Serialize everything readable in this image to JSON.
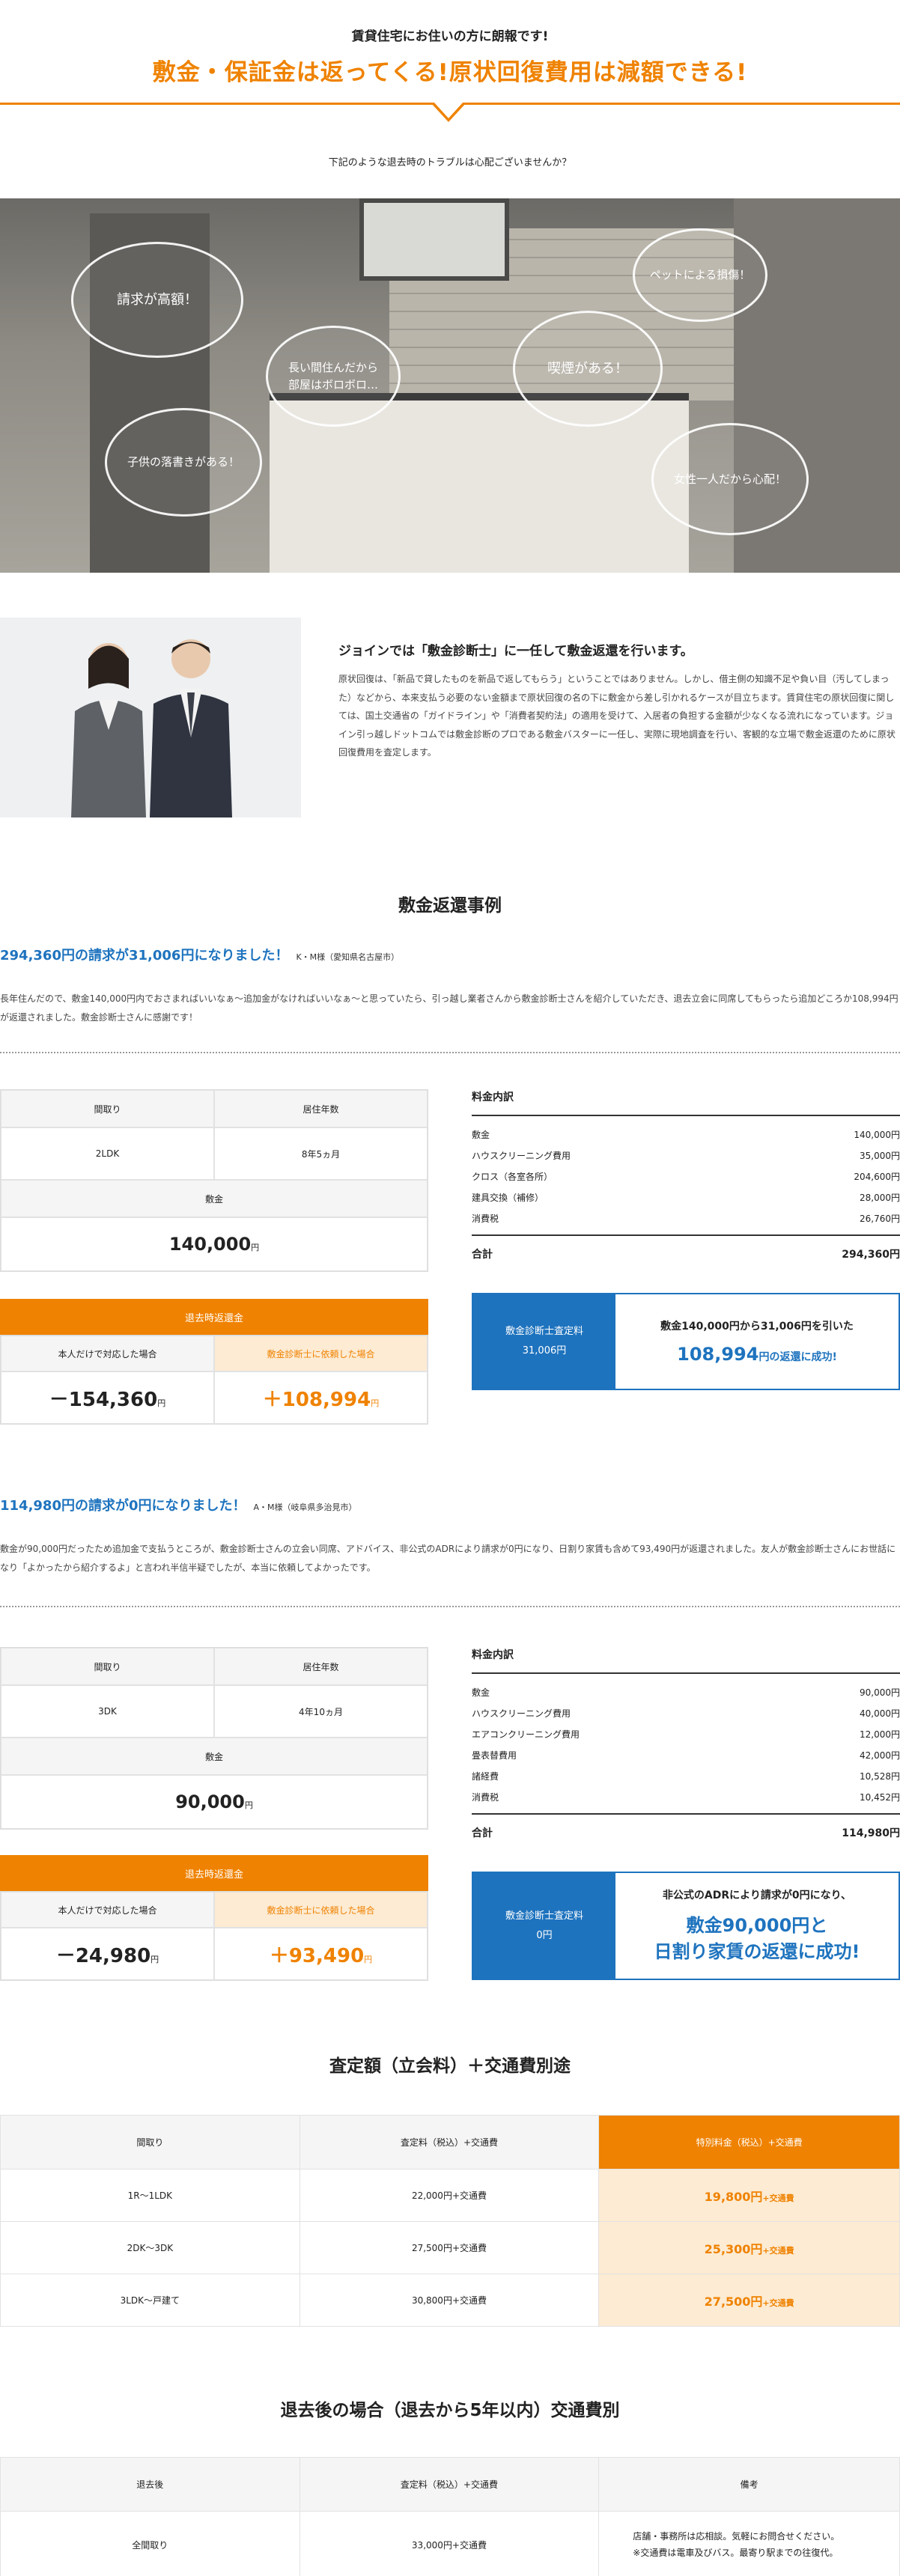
{
  "hero": {
    "subtitle": "賃貸住宅にお住いの方に朗報です!",
    "title": "敷金・保証金は返ってくる!原状回復費用は減額できる!"
  },
  "question": "下記のような退去時のトラブルは心配ございませんか？",
  "bubbles": {
    "b1": "請求が高額！",
    "b2a": "長い間住んだから",
    "b2b": "部屋はボロボロ…",
    "b3": "子供の落書きがある！",
    "b4": "喫煙がある！",
    "b5": "ペットによる損傷！",
    "b6": "女性一人だから心配！"
  },
  "intro": {
    "title": "ジョインでは「敷金診断士」に一任して敷金返還を行います。",
    "text": "原状回復は、「新品で貸したものを新品で返してもらう」ということではありません。しかし、借主側の知識不足や負い目（汚してしまった）などから、本来支払う必要のない金額まで原状回復の名の下に敷金から差し引かれるケースが目立ちます。賃貸住宅の原状回復に関しては、国土交通省の「ガイドライン」や「消費者契約法」の適用を受けて、入居者の負担する金額が少なくなる流れになっています。ジョイン引っ越しドットコムでは敷金診断のプロである敷金バスターに一任し、実際に現地調査を行い、客観的な立場で敷金返還のために原状回復費用を査定します。"
  },
  "cases_title": "敷金返還事例",
  "labels": {
    "madori": "間取り",
    "years": "居住年数",
    "deposit": "敷金",
    "yen": "円",
    "return_title": "退去時返還金",
    "self": "本人だけで対応した場合",
    "request": "敷金診断士に依頼した場合",
    "fee_title": "料金内訳",
    "total": "合計",
    "assess_fee": "敷金診断士査定料"
  },
  "case1": {
    "heading": "294,360円の請求が31,006円になりました！",
    "person": "K・M様（愛知県名古屋市）",
    "text": "長年住んだので、敷金140,000円内でおさまればいいなぁ〜追加金がなければいいなぁ〜と思っていたら、引っ越し業者さんから敷金診断士さんを紹介していただき、退去立会に同席してもらったら追加どころか108,994円が返還されました。敷金診断士さんに感謝です！",
    "madori": "2LDK",
    "years": "8年5ヵ月",
    "deposit": "140,000",
    "self_amount": "－154,360",
    "request_amount": "＋108,994",
    "fees": [
      {
        "name": "敷金",
        "value": "140,000円"
      },
      {
        "name": "ハウスクリーニング費用",
        "value": "35,000円"
      },
      {
        "name": "クロス（各室各所）",
        "value": "204,600円"
      },
      {
        "name": "建具交換（補修）",
        "value": "28,000円"
      },
      {
        "name": "消費税",
        "value": "26,760円"
      }
    ],
    "total": "294,360円",
    "assess_value": "31,006円",
    "result1": "敷金140,000円から31,006円を引いた",
    "result2": "108,994",
    "result2_suffix": "円の返還に成功!"
  },
  "case2": {
    "heading": "114,980円の請求が0円になりました！",
    "person": "A・M様（岐阜県多治見市）",
    "text": "敷金が90,000円だったため追加金で支払うところが、敷金診断士さんの立会い同席、アドバイス、非公式のADRにより請求が0円になり、日割り家賃も含めて93,490円が返還されました。友人が敷金診断士さんにお世話になり「よかったから紹介するよ」と言われ半信半疑でしたが、本当に依頼してよかったです。",
    "madori": "3DK",
    "years": "4年10ヵ月",
    "deposit": "90,000",
    "self_amount": "－24,980",
    "request_amount": "＋93,490",
    "fees": [
      {
        "name": "敷金",
        "value": "90,000円"
      },
      {
        "name": "ハウスクリーニング費用",
        "value": "40,000円"
      },
      {
        "name": "エアコンクリーニング費用",
        "value": "12,000円"
      },
      {
        "name": "畳表替費用",
        "value": "42,000円"
      },
      {
        "name": "諸経費",
        "value": "10,528円"
      },
      {
        "name": "消費税",
        "value": "10,452円"
      }
    ],
    "total": "114,980円",
    "assess_value": "0円",
    "result1": "非公式のADRにより請求が0円になり、",
    "result2": "敷金90,000円と",
    "result3": "日割り家賃の返還に成功!"
  },
  "pricing": {
    "title": "査定額（立会料）＋交通費別途",
    "headers": [
      "間取り",
      "査定料（税込）+交通費",
      "特別料金（税込）+交通費"
    ],
    "rows": [
      {
        "madori": "1R〜1LDK",
        "price": "22,000円+交通費",
        "special": "19,800円",
        "special_suffix": "+交通費"
      },
      {
        "madori": "2DK〜3DK",
        "price": "27,500円+交通費",
        "special": "25,300円",
        "special_suffix": "+交通費"
      },
      {
        "madori": "3LDK〜戸建て",
        "price": "30,800円+交通費",
        "special": "27,500円",
        "special_suffix": "+交通費"
      }
    ]
  },
  "after": {
    "title": "退去後の場合（退去から5年以内）交通費別",
    "headers": [
      "退去後",
      "査定料（税込）+交通費",
      "備考"
    ],
    "row": {
      "name": "全間取り",
      "price": "33,000円+交通費",
      "note1": "店舗・事務所は応相談。気軽にお問合せください。",
      "note2": "※交通費は電車及びバス。最寄り駅までの往復代。"
    }
  },
  "colors": {
    "accent": "#ef8200",
    "blue": "#1e73be",
    "light_orange": "#fdebd3"
  }
}
